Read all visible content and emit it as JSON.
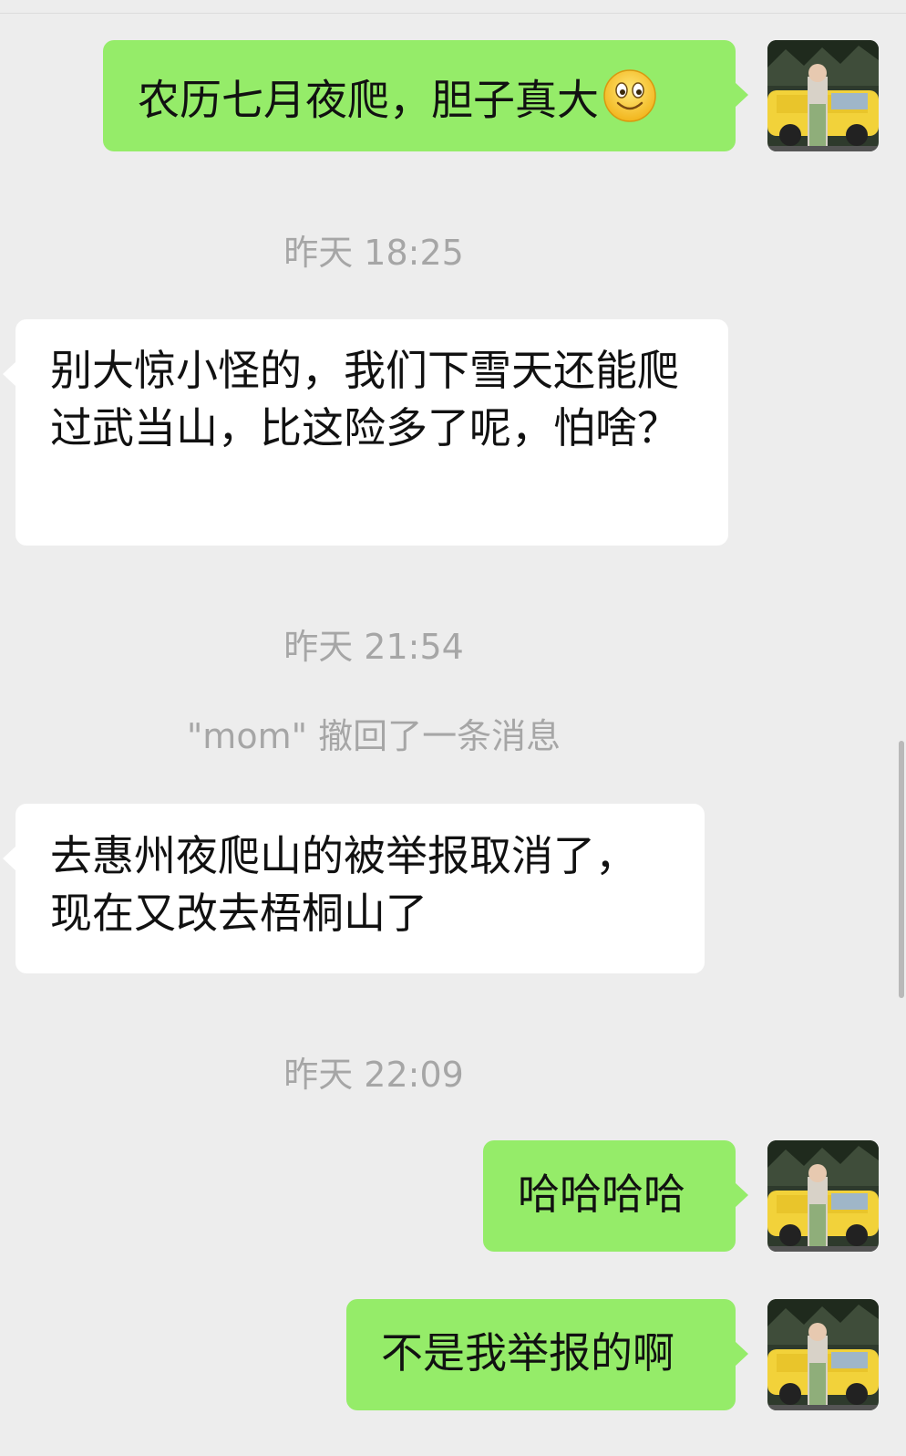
{
  "chat": {
    "contact_name": "mom",
    "messages": [
      {
        "id": 1,
        "direction": "out",
        "text": "农历七月夜爬，胆子真大",
        "emoji": "smile-emoji"
      },
      {
        "id": 2,
        "direction": "in",
        "text": "别大惊小怪的，我们下雪天还能爬过武当山，比这险多了呢，怕啥？"
      },
      {
        "id": 3,
        "direction": "in",
        "text": "去惠州夜爬山的被举报取消了，现在又改去梧桐山了"
      },
      {
        "id": 4,
        "direction": "out",
        "text": "哈哈哈哈"
      },
      {
        "id": 5,
        "direction": "out",
        "text": "不是我举报的啊"
      }
    ],
    "timestamps": [
      "昨天 18:25",
      "昨天 21:54",
      "昨天 22:09"
    ],
    "system_notice": "\"mom\" 撤回了一条消息"
  },
  "colors": {
    "background": "#ededed",
    "outgoing_bubble": "#95ec69",
    "incoming_bubble": "#ffffff",
    "timestamp_text": "#a6a6a6"
  },
  "icons": {
    "avatar": "user-avatar-photo",
    "emoji": "smile-emoji"
  }
}
